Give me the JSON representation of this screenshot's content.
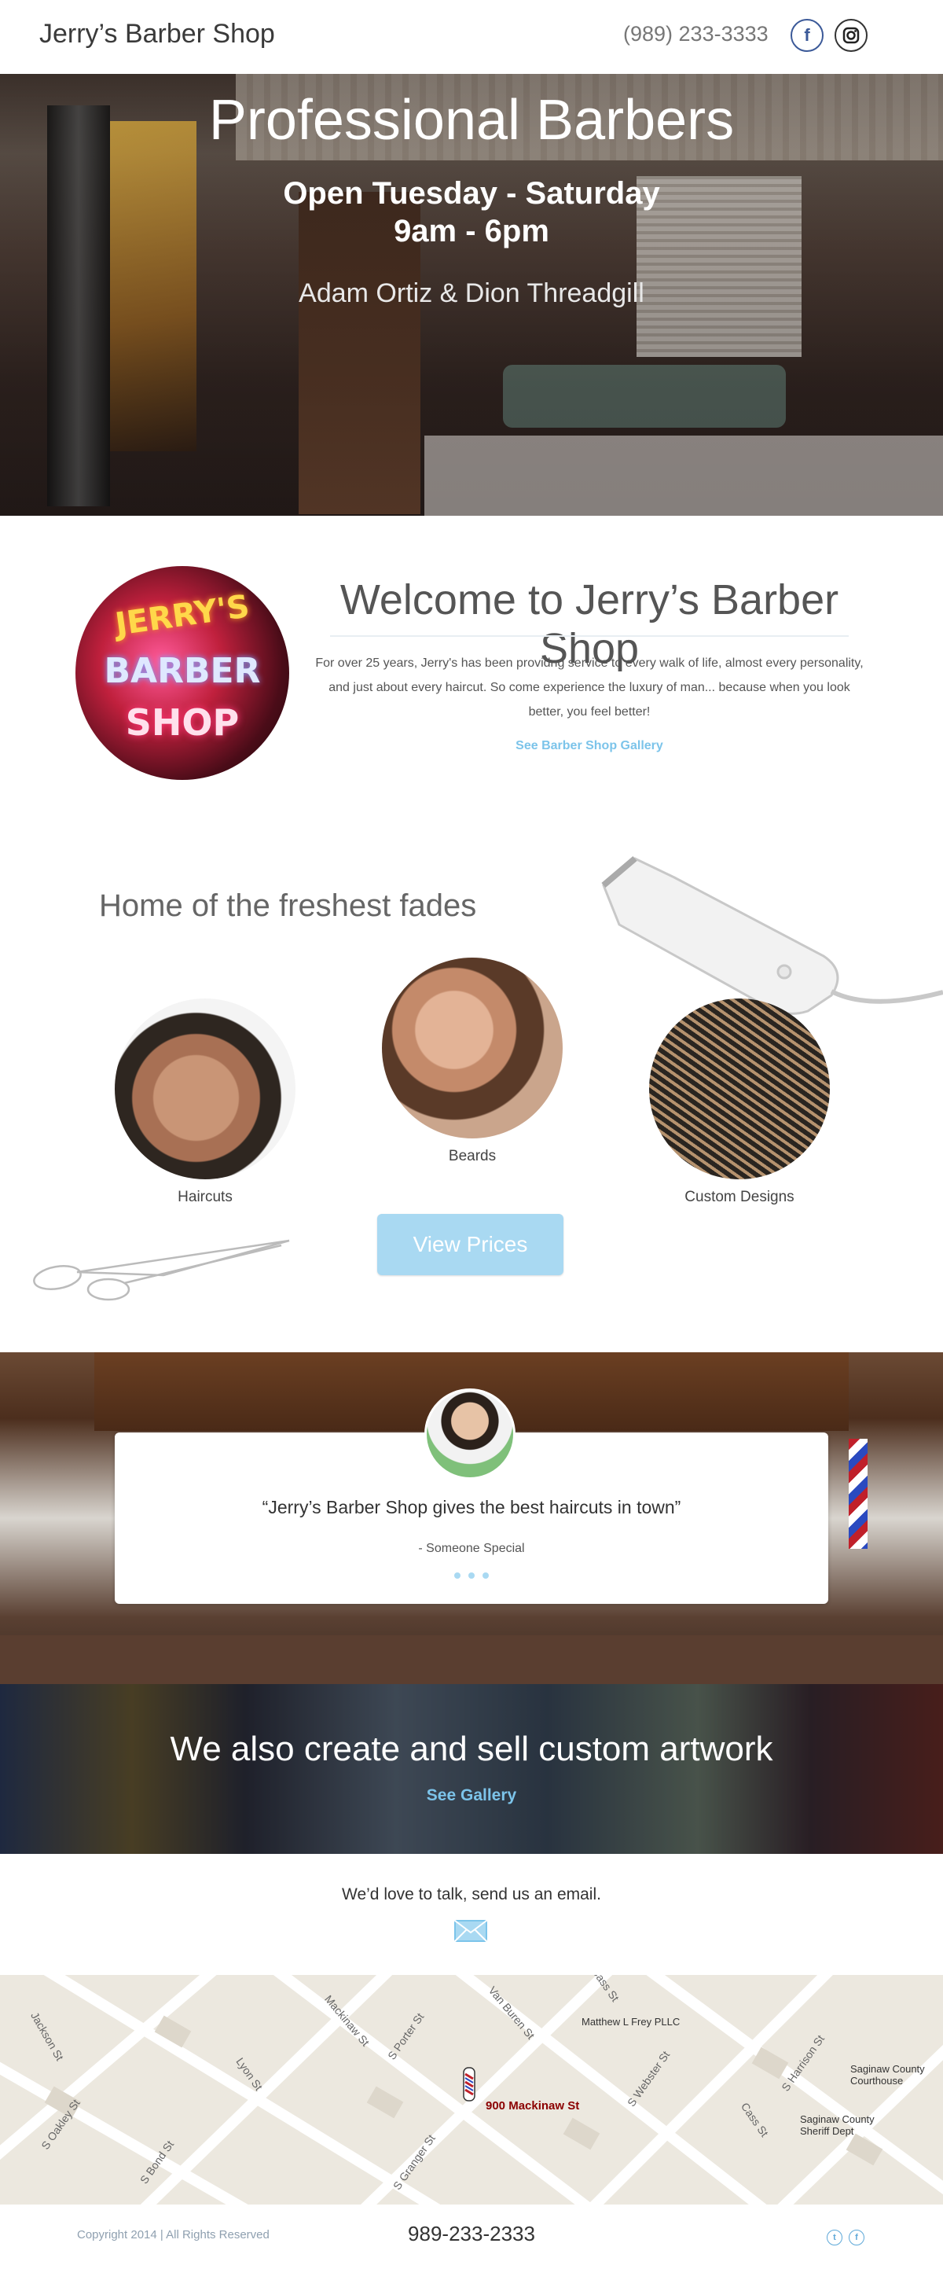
{
  "header": {
    "brand": "Jerry’s Barber Shop",
    "phone": "(989) 233-3333",
    "facebook_icon": "f",
    "instagram_icon": "instagram"
  },
  "hero": {
    "title": "Professional Barbers",
    "open_days": "Open Tuesday - Saturday",
    "hours": "9am - 6pm",
    "barbers": "Adam Ortiz & Dion Threadgill"
  },
  "welcome": {
    "neon_line1": "JERRY'S",
    "neon_line2": "BARBER",
    "neon_line3": "SHOP",
    "title": "Welcome to Jerry’s Barber Shop",
    "text": "For over 25 years, Jerry's has been providng service to every walk of life, almost every personality, and just about every haircut.  So come experience the luxury of man... because when you look better, you feel better!",
    "gallery_link": "See Barber Shop Gallery"
  },
  "fades": {
    "title": "Home of the freshest fades",
    "items": [
      {
        "label": "Haircuts"
      },
      {
        "label": "Beards"
      },
      {
        "label": "Custom Designs"
      }
    ],
    "button": "View Prices"
  },
  "testimonial": {
    "quote": "“Jerry’s Barber Shop gives the best haircuts in town”",
    "author": "- Someone Special"
  },
  "artwork": {
    "title": "We also create and sell custom artwork",
    "link": "See Gallery"
  },
  "contact": {
    "text": "We’d love to talk, send us an email."
  },
  "map": {
    "pin_label": "900 Mackinaw St",
    "places": {
      "frey": "Matthew L Frey PLLC",
      "courthouse": "Saginaw County Courthouse",
      "sheriff": "Saginaw County Sheriff Dept"
    },
    "streets": [
      "Jackson St",
      "Lyon St",
      "S Oakley St",
      "S Bond St",
      "Mackinaw St",
      "S Porter St",
      "Van Buren St",
      "Cass St",
      "S Webster St",
      "S Harrison St",
      "S Granger St",
      "Cass St"
    ]
  },
  "footer": {
    "copyright": "Copyright 2014 | All Rights Reserved",
    "phone": "989-233-2333",
    "twitter_icon": "t",
    "facebook_icon": "f"
  },
  "colors": {
    "accent": "#7cc4ea",
    "button": "#a9d9f2"
  }
}
